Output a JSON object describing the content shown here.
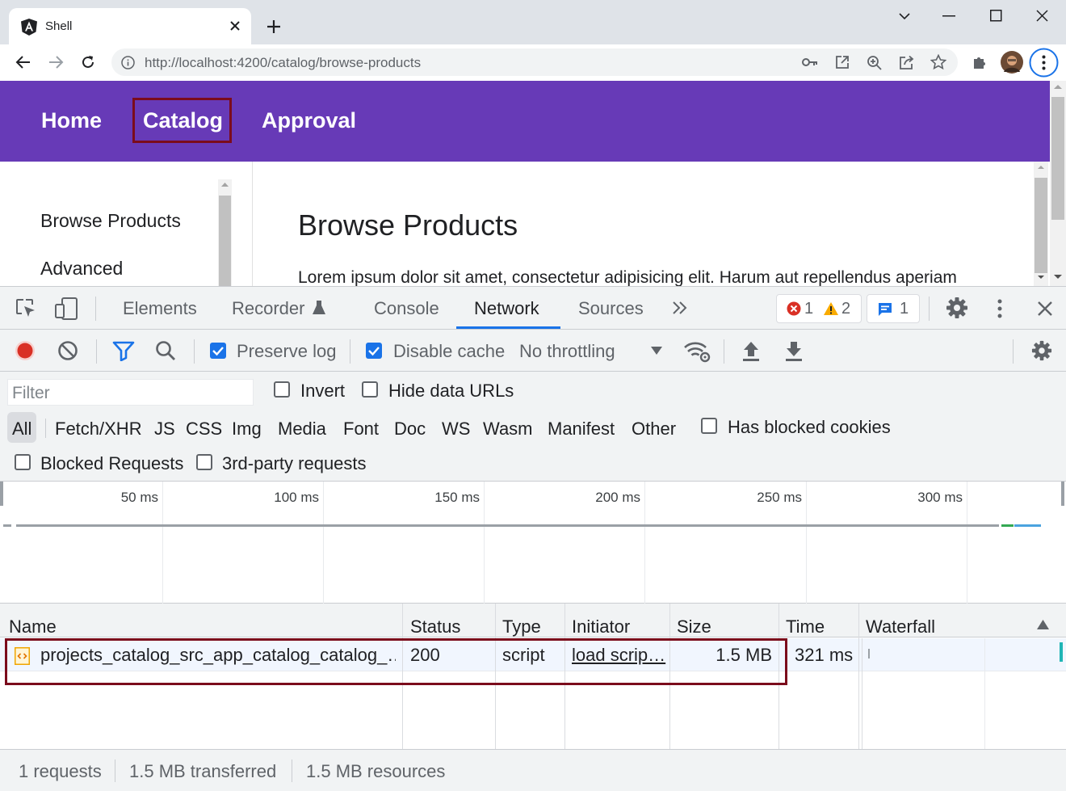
{
  "browser": {
    "tab_title": "Shell",
    "url": "http://localhost:4200/catalog/browse-products"
  },
  "app": {
    "nav": [
      "Home",
      "Catalog",
      "Approval"
    ],
    "sidebar": [
      "Browse Products",
      "Advanced"
    ],
    "title": "Browse Products",
    "paragraph": "Lorem ipsum dolor sit amet, consectetur adipisicing elit. Harum aut repellendus aperiam"
  },
  "devtools": {
    "tabs": [
      "Elements",
      "Recorder",
      "Console",
      "Network",
      "Sources"
    ],
    "active_tab": "Network",
    "counts": {
      "errors": "1",
      "warnings": "2",
      "messages": "1"
    },
    "toolbar": {
      "preserve_log": "Preserve log",
      "preserve_log_checked": true,
      "disable_cache": "Disable cache",
      "disable_cache_checked": true,
      "throttling": "No throttling"
    },
    "filter": {
      "placeholder": "Filter",
      "invert": "Invert",
      "hide_data_urls": "Hide data URLs",
      "types": [
        "All",
        "Fetch/XHR",
        "JS",
        "CSS",
        "Img",
        "Media",
        "Font",
        "Doc",
        "WS",
        "Wasm",
        "Manifest",
        "Other"
      ],
      "has_blocked_cookies": "Has blocked cookies",
      "blocked_requests": "Blocked Requests",
      "third_party": "3rd-party requests"
    },
    "timeline": {
      "ticks": [
        "50 ms",
        "100 ms",
        "150 ms",
        "200 ms",
        "250 ms",
        "300 ms"
      ]
    },
    "table": {
      "columns": [
        "Name",
        "Status",
        "Type",
        "Initiator",
        "Size",
        "Time",
        "Waterfall"
      ],
      "rows": [
        {
          "name": "projects_catalog_src_app_catalog_catalog_…",
          "status": "200",
          "type": "script",
          "initiator": "load scrip…",
          "size": "1.5 MB",
          "time": "321 ms"
        }
      ]
    },
    "status": {
      "requests": "1 requests",
      "transferred": "1.5 MB transferred",
      "resources": "1.5 MB resources"
    }
  },
  "colors": {
    "appbar": "#673ab7",
    "highlight_box": "#7b0c1c",
    "accent": "#1a73e8",
    "record": "#d93025"
  }
}
